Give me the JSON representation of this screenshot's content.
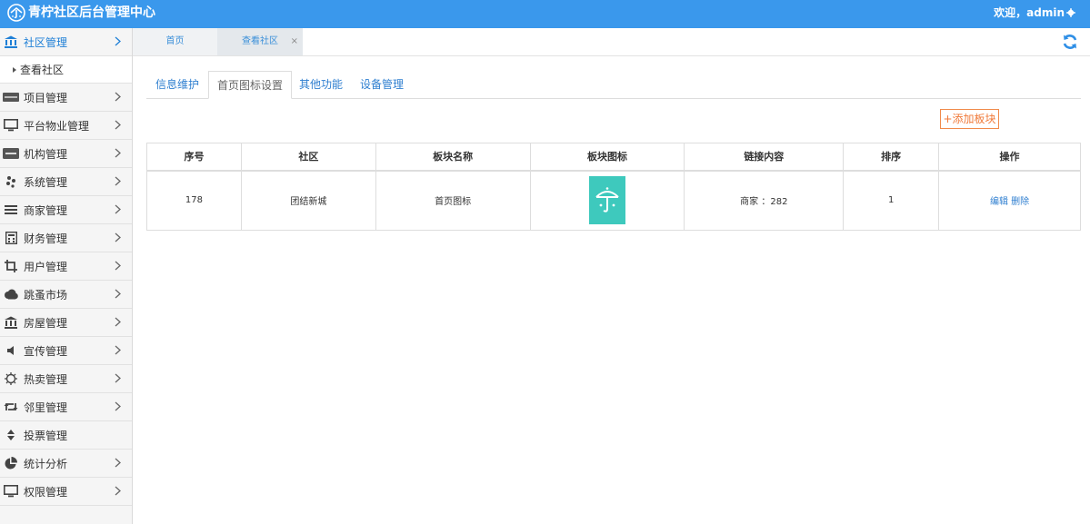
{
  "header": {
    "title": "青柠社区后台管理中心",
    "welcome": "欢迎，admin"
  },
  "sidebar": {
    "items": [
      {
        "label": "社区管理",
        "icon": "bank-icon",
        "active": true
      },
      {
        "label": "项目管理",
        "icon": "discover-card-icon"
      },
      {
        "label": "平台物业管理",
        "icon": "monitor-icon"
      },
      {
        "label": "机构管理",
        "icon": "stripe-icon"
      },
      {
        "label": "系统管理",
        "icon": "yelp-icon"
      },
      {
        "label": "商家管理",
        "icon": "bars-icon"
      },
      {
        "label": "财务管理",
        "icon": "calculator-icon"
      },
      {
        "label": "用户管理",
        "icon": "crop-icon"
      },
      {
        "label": "跳蚤市场",
        "icon": "cloud-icon"
      },
      {
        "label": "房屋管理",
        "icon": "bank-icon"
      },
      {
        "label": "宣传管理",
        "icon": "volume-icon"
      },
      {
        "label": "热卖管理",
        "icon": "sun-icon"
      },
      {
        "label": "邻里管理",
        "icon": "retweet-icon"
      },
      {
        "label": "投票管理",
        "icon": "sort-icon"
      },
      {
        "label": "统计分析",
        "icon": "pie-chart-icon"
      },
      {
        "label": "权限管理",
        "icon": "monitor-icon"
      }
    ],
    "sub_item": "查看社区"
  },
  "tabs": {
    "home": "首页",
    "current": "查看社区",
    "close": "×"
  },
  "subtabs": [
    "信息维护",
    "首页图标设置",
    "其他功能",
    "设备管理"
  ],
  "toolbar": {
    "add_label": "+添加板块"
  },
  "table": {
    "headers": [
      "序号",
      "社区",
      "板块名称",
      "板块图标",
      "链接内容",
      "排序",
      "操作"
    ],
    "rows": [
      {
        "id": "178",
        "community": "团结新城",
        "block_name": "首页图标",
        "icon": "umbrella-icon",
        "link": "商家 ：282",
        "order": "1",
        "edit": "编辑",
        "delete": "删除"
      }
    ]
  },
  "colors": {
    "topbar": "#3a98ec",
    "accent": "#2f7fd0",
    "add_button": "#f07a3a",
    "icon_tile": "#3ec9bd"
  }
}
